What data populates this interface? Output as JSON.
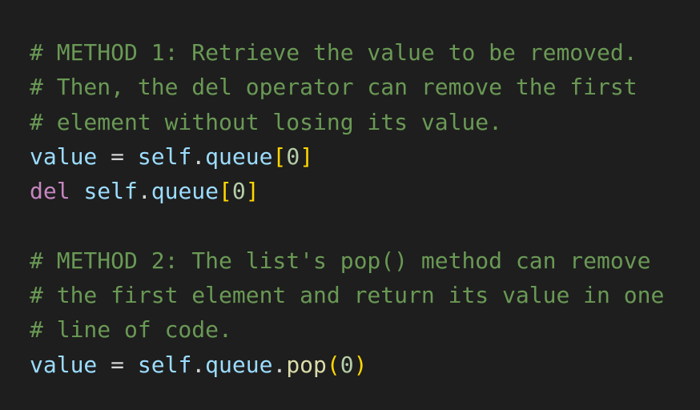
{
  "colors": {
    "background": "#1e1e1e",
    "comment": "#6a9955",
    "variable": "#9cdcfe",
    "operator": "#d4d4d4",
    "keyword": "#c586c0",
    "function": "#dcdcaa",
    "number": "#b5cea8",
    "bracket": "#ffd700"
  },
  "lines": [
    [
      {
        "t": "comment",
        "v": "# METHOD 1: Retrieve the value to be removed."
      }
    ],
    [
      {
        "t": "comment",
        "v": "# Then, the del operator can remove the first"
      }
    ],
    [
      {
        "t": "comment",
        "v": "# element without losing its value."
      }
    ],
    [
      {
        "t": "var",
        "v": "value"
      },
      {
        "t": "op",
        "v": " = "
      },
      {
        "t": "var",
        "v": "self"
      },
      {
        "t": "op",
        "v": "."
      },
      {
        "t": "var",
        "v": "queue"
      },
      {
        "t": "br",
        "v": "["
      },
      {
        "t": "num",
        "v": "0"
      },
      {
        "t": "br",
        "v": "]"
      }
    ],
    [
      {
        "t": "kw",
        "v": "del"
      },
      {
        "t": "op",
        "v": " "
      },
      {
        "t": "var",
        "v": "self"
      },
      {
        "t": "op",
        "v": "."
      },
      {
        "t": "var",
        "v": "queue"
      },
      {
        "t": "br",
        "v": "["
      },
      {
        "t": "num",
        "v": "0"
      },
      {
        "t": "br",
        "v": "]"
      }
    ],
    [],
    [
      {
        "t": "comment",
        "v": "# METHOD 2: The list's pop() method can remove"
      }
    ],
    [
      {
        "t": "comment",
        "v": "# the first element and return its value in one"
      }
    ],
    [
      {
        "t": "comment",
        "v": "# line of code."
      }
    ],
    [
      {
        "t": "var",
        "v": "value"
      },
      {
        "t": "op",
        "v": " = "
      },
      {
        "t": "var",
        "v": "self"
      },
      {
        "t": "op",
        "v": "."
      },
      {
        "t": "var",
        "v": "queue"
      },
      {
        "t": "op",
        "v": "."
      },
      {
        "t": "fn",
        "v": "pop"
      },
      {
        "t": "br",
        "v": "("
      },
      {
        "t": "num",
        "v": "0"
      },
      {
        "t": "br",
        "v": ")"
      }
    ]
  ]
}
